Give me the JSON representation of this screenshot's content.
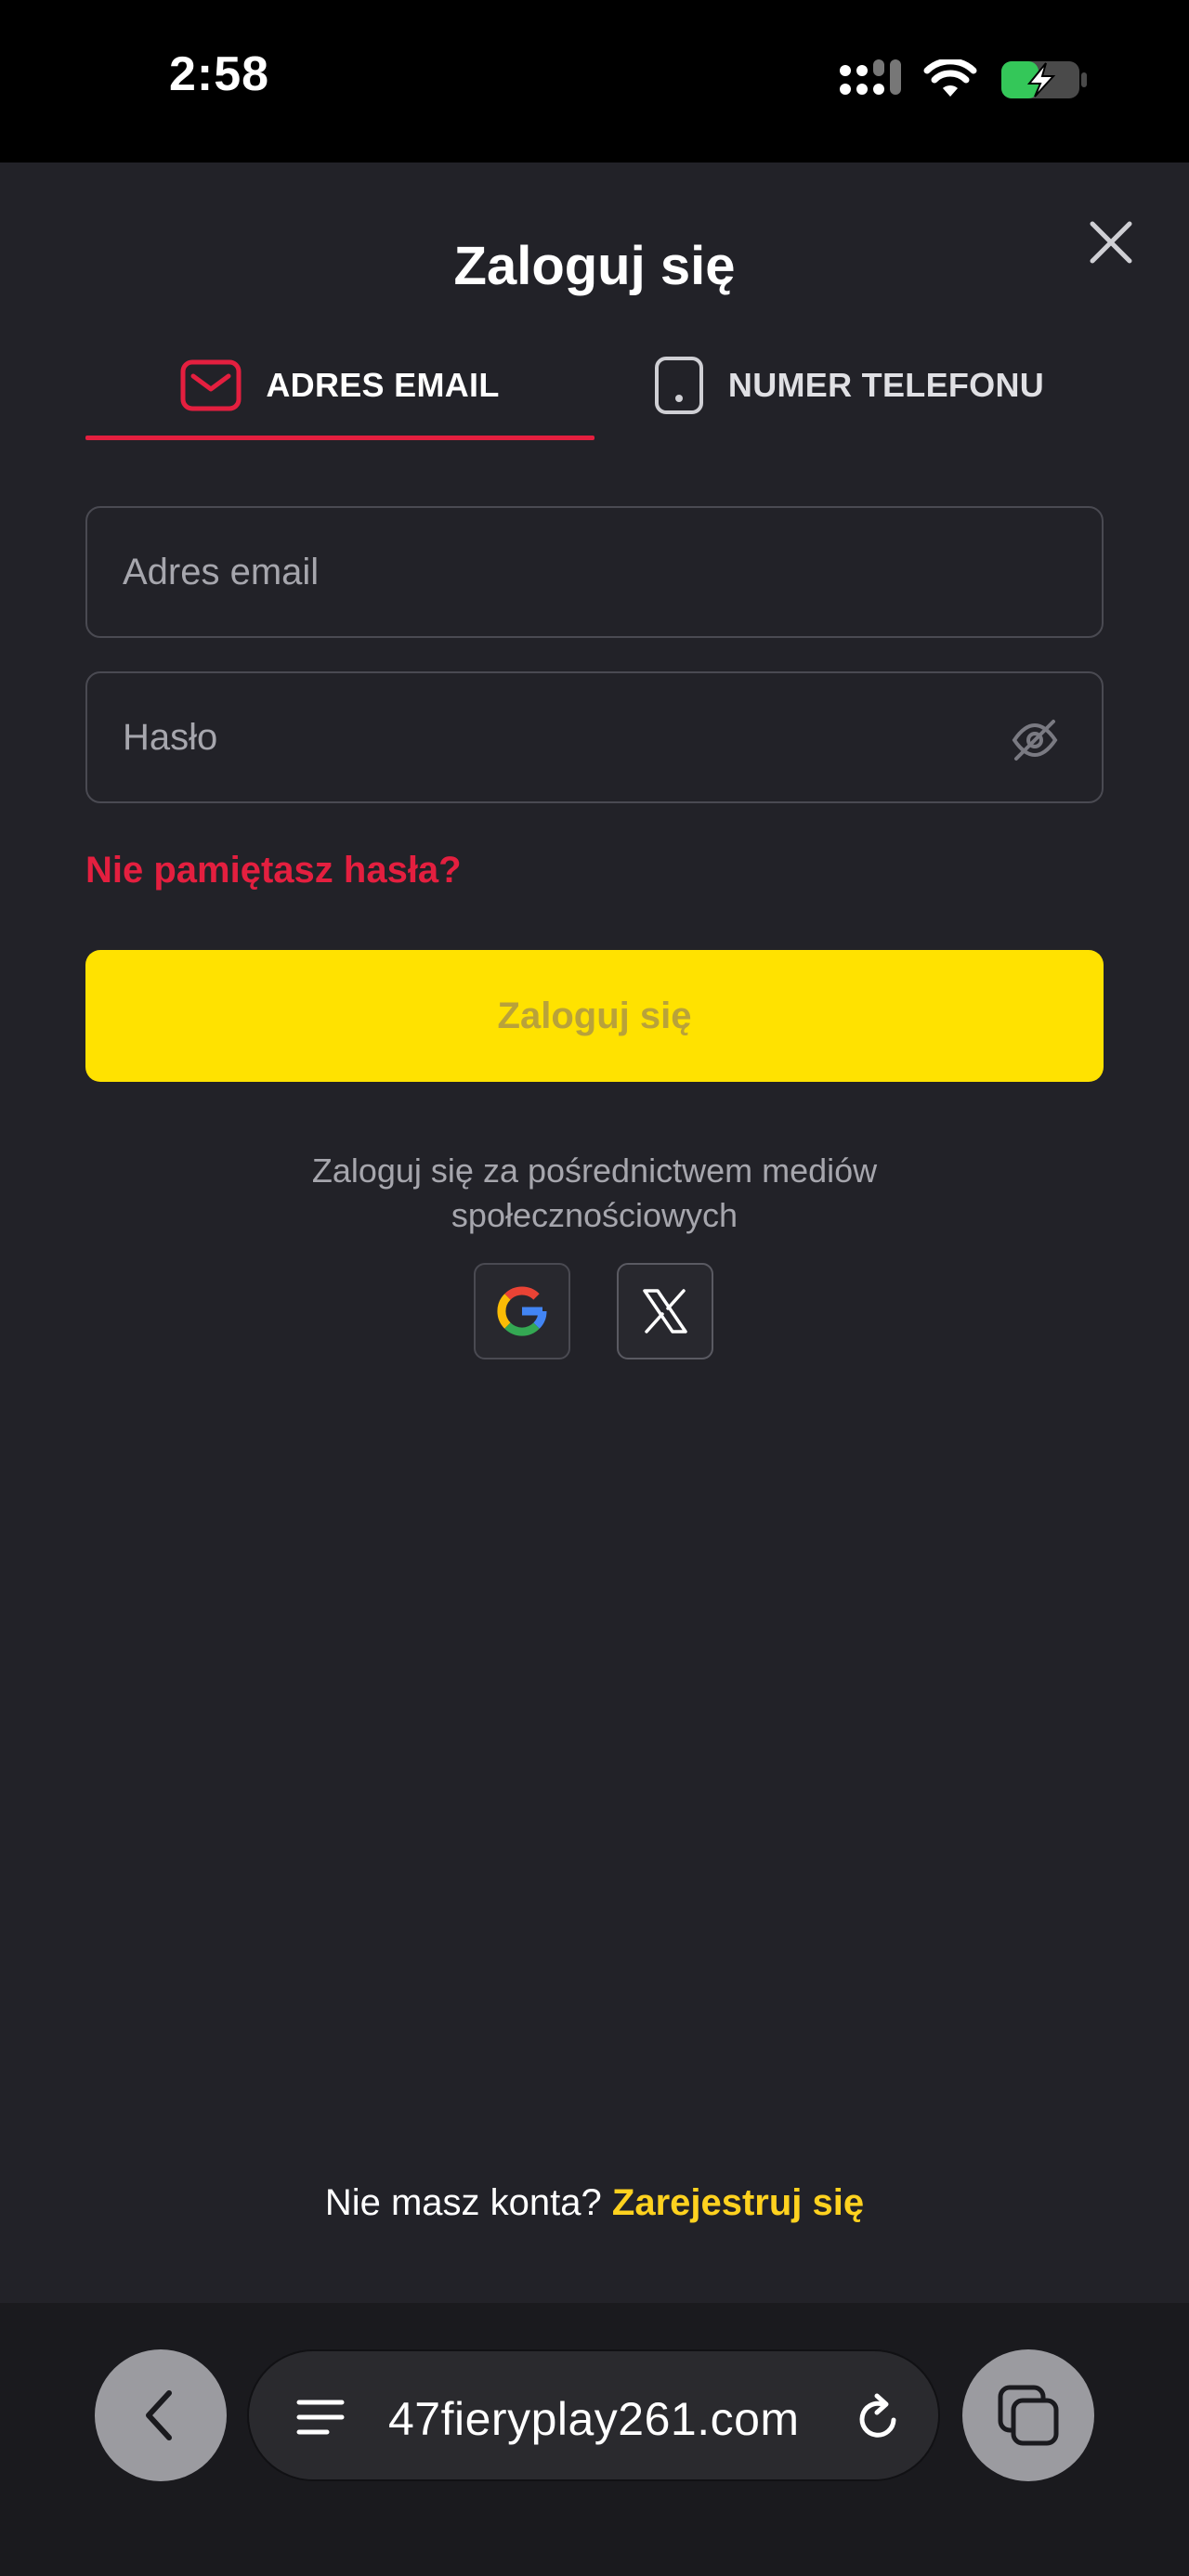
{
  "status_bar": {
    "time": "2:58",
    "icons": [
      "signal-icon",
      "wifi-icon",
      "battery-charging-icon"
    ]
  },
  "modal": {
    "title": "Zaloguj się",
    "close_icon": "close-icon",
    "tabs": [
      {
        "label": "ADRES EMAIL",
        "icon": "mail-icon",
        "active": true
      },
      {
        "label": "NUMER TELEFONU",
        "icon": "phone-icon",
        "active": false
      }
    ],
    "email_placeholder": "Adres email",
    "password_placeholder": "Hasło",
    "forgot_password": "Nie pamiętasz hasła?",
    "login_button": "Zaloguj się",
    "social_text": "Zaloguj się za pośrednictwem mediów społecznościowych",
    "social_buttons": [
      "google-icon",
      "x-icon"
    ],
    "register_prompt": "Nie masz konta?",
    "register_link": "Zarejestruj się"
  },
  "browser": {
    "url": "47fieryplay261.com"
  },
  "colors": {
    "background": "#222228",
    "accent_red": "#e41f3f",
    "button_yellow": "#ffe200",
    "link_yellow": "#ffd21f"
  }
}
